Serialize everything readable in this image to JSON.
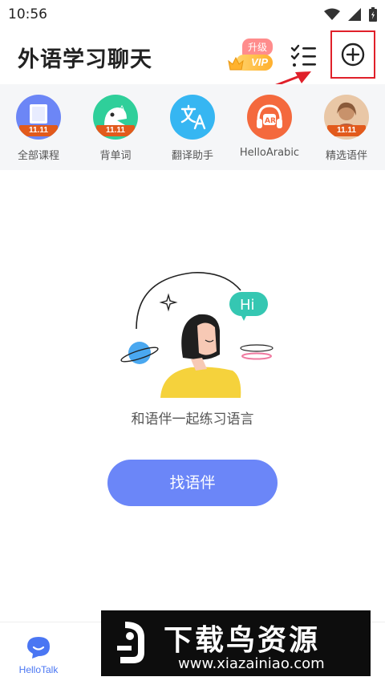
{
  "status_bar": {
    "time": "10:56",
    "icons": [
      "wifi-icon",
      "signal-icon",
      "battery-icon"
    ]
  },
  "header": {
    "title": "外语学习聊天",
    "vip": {
      "top_label": "升级",
      "label": "VIP"
    },
    "todo_icon": "checklist-icon",
    "add_icon": "plus-circle-icon"
  },
  "shortcuts": [
    {
      "label": "全部课程",
      "tag": "11.11",
      "icon": "book-icon",
      "color": "#6c86f6"
    },
    {
      "label": "背单词",
      "tag": "11.11",
      "icon": "word-monster-icon",
      "color": "#2fcf9a"
    },
    {
      "label": "翻译助手",
      "tag": "",
      "icon": "translate-icon",
      "color": "#36b6f2"
    },
    {
      "label": "HelloArabic",
      "tag": "",
      "icon": "ar-headphone-icon",
      "color": "#f4693d"
    },
    {
      "label": "精选语伴",
      "tag": "11.11",
      "icon": "partner-avatar-icon",
      "color": "#d9a07a"
    }
  ],
  "empty_state": {
    "bubble": "Hi",
    "message": "和语伴一起练习语言",
    "button": "找语伴"
  },
  "bottom_nav": {
    "hellotalk_label": "HelloTalk"
  },
  "watermark": {
    "title": "下载鸟资源",
    "url": "www.xiazainiao.com"
  },
  "colors": {
    "primary": "#6b86f8",
    "highlight": "#e0202a",
    "tag": "#e25a1c",
    "teal": "#35c7b2"
  }
}
